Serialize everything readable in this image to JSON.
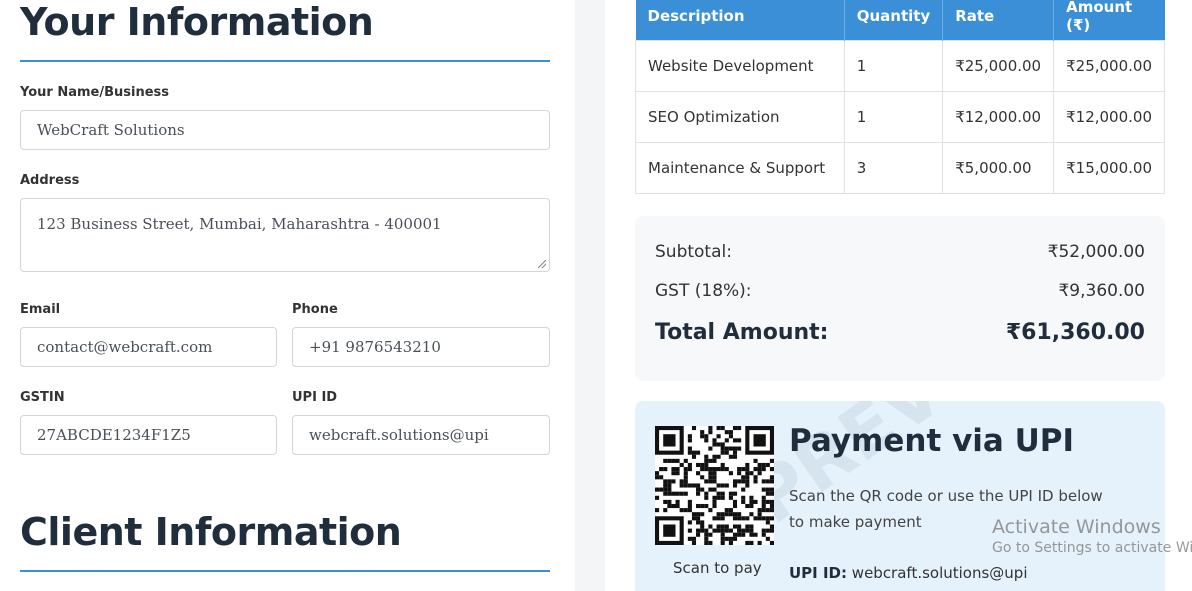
{
  "your_info": {
    "title": "Your Information",
    "name_label": "Your Name/Business",
    "name_value": "WebCraft Solutions",
    "address_label": "Address",
    "address_value": "123 Business Street, Mumbai, Maharashtra - 400001",
    "email_label": "Email",
    "email_value": "contact@webcraft.com",
    "phone_label": "Phone",
    "phone_value": "+91 9876543210",
    "gstin_label": "GSTIN",
    "gstin_value": "27ABCDE1234F1Z5",
    "upi_label": "UPI ID",
    "upi_value": "webcraft.solutions@upi"
  },
  "client_info": {
    "title": "Client Information"
  },
  "items_table": {
    "headers": [
      "Description",
      "Quantity",
      "Rate",
      "Amount (₹)"
    ],
    "rows": [
      [
        "Website Development",
        "1",
        "₹25,000.00",
        "₹25,000.00"
      ],
      [
        "SEO Optimization",
        "1",
        "₹12,000.00",
        "₹12,000.00"
      ],
      [
        "Maintenance & Support",
        "3",
        "₹5,000.00",
        "₹15,000.00"
      ]
    ]
  },
  "totals": {
    "subtotal_label": "Subtotal:",
    "subtotal_value": "₹52,000.00",
    "gst_label": "GST (18%):",
    "gst_value": "₹9,360.00",
    "total_label": "Total Amount:",
    "total_value": "₹61,360.00"
  },
  "payment": {
    "title": "Payment via UPI",
    "instruction": "Scan the QR code or use the UPI ID below to make payment",
    "scan_caption": "Scan to pay",
    "upi_label": "UPI ID:",
    "upi_value": "webcraft.solutions@upi",
    "watermark": "PREVIEW"
  },
  "os_overlay": {
    "line1": "Activate Windows",
    "line2": "Go to Settings to activate Windows."
  },
  "colors": {
    "accent": "#3a8fd6",
    "heading": "#1f2d3d",
    "upi_panel": "#e5f1fb",
    "totals_panel": "#f6f8f9"
  }
}
